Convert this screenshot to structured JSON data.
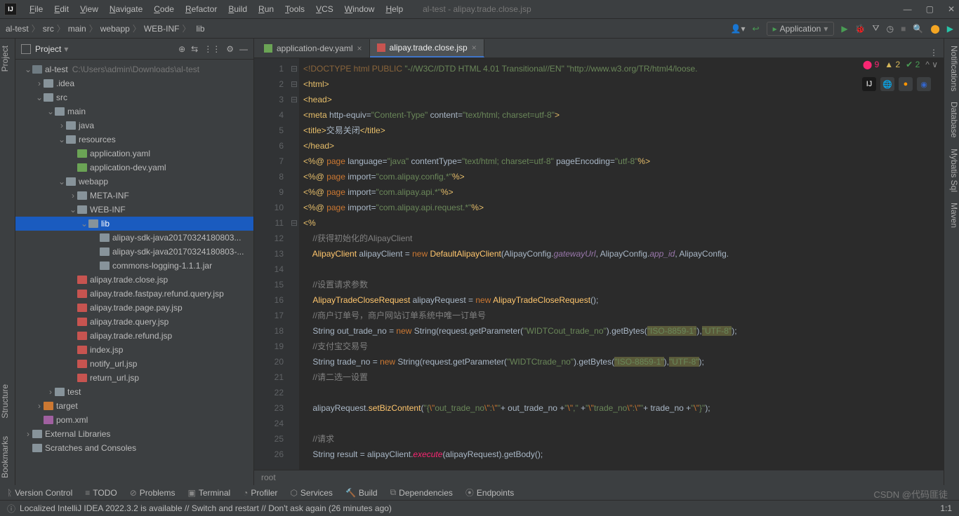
{
  "window_title": "al-test - alipay.trade.close.jsp",
  "menu": [
    "File",
    "Edit",
    "View",
    "Navigate",
    "Code",
    "Refactor",
    "Build",
    "Run",
    "Tools",
    "VCS",
    "Window",
    "Help"
  ],
  "breadcrumbs": [
    "al-test",
    "src",
    "main",
    "webapp",
    "WEB-INF",
    "lib"
  ],
  "run_config": "Application",
  "project_label": "Project",
  "tree": [
    {
      "d": 0,
      "a": "v",
      "i": "fdir-root",
      "t": "al-test",
      "suf": "C:\\Users\\admin\\Downloads\\al-test"
    },
    {
      "d": 1,
      "a": ">",
      "i": "fdir",
      "t": ".idea"
    },
    {
      "d": 1,
      "a": "v",
      "i": "fdir",
      "t": "src"
    },
    {
      "d": 2,
      "a": "v",
      "i": "fdir",
      "t": "main"
    },
    {
      "d": 3,
      "a": ">",
      "i": "fdir",
      "t": "java"
    },
    {
      "d": 3,
      "a": "v",
      "i": "fdir",
      "t": "resources"
    },
    {
      "d": 4,
      "a": "",
      "i": "fyaml",
      "t": "application.yaml"
    },
    {
      "d": 4,
      "a": "",
      "i": "fyaml",
      "t": "application-dev.yaml"
    },
    {
      "d": 3,
      "a": "v",
      "i": "fdir",
      "t": "webapp"
    },
    {
      "d": 4,
      "a": ">",
      "i": "fdir",
      "t": "META-INF"
    },
    {
      "d": 4,
      "a": "v",
      "i": "fdir",
      "t": "WEB-INF"
    },
    {
      "d": 5,
      "a": "v",
      "i": "fdir",
      "t": "lib",
      "sel": true
    },
    {
      "d": 6,
      "a": "",
      "i": "fjar",
      "t": "alipay-sdk-java20170324180803..."
    },
    {
      "d": 6,
      "a": "",
      "i": "fjar",
      "t": "alipay-sdk-java20170324180803-..."
    },
    {
      "d": 6,
      "a": "",
      "i": "fjar",
      "t": "commons-logging-1.1.1.jar"
    },
    {
      "d": 4,
      "a": "",
      "i": "fjsp",
      "t": "alipay.trade.close.jsp"
    },
    {
      "d": 4,
      "a": "",
      "i": "fjsp",
      "t": "alipay.trade.fastpay.refund.query.jsp"
    },
    {
      "d": 4,
      "a": "",
      "i": "fjsp",
      "t": "alipay.trade.page.pay.jsp"
    },
    {
      "d": 4,
      "a": "",
      "i": "fjsp",
      "t": "alipay.trade.query.jsp"
    },
    {
      "d": 4,
      "a": "",
      "i": "fjsp",
      "t": "alipay.trade.refund.jsp"
    },
    {
      "d": 4,
      "a": "",
      "i": "fjsp",
      "t": "index.jsp"
    },
    {
      "d": 4,
      "a": "",
      "i": "fjsp",
      "t": "notify_url.jsp"
    },
    {
      "d": 4,
      "a": "",
      "i": "fjsp",
      "t": "return_url.jsp"
    },
    {
      "d": 2,
      "a": ">",
      "i": "fdir",
      "t": "test"
    },
    {
      "d": 1,
      "a": ">",
      "i": "flib-orange",
      "t": "target"
    },
    {
      "d": 1,
      "a": "",
      "i": "flib-purple",
      "t": "pom.xml",
      "italic": true,
      "col": "#8888cc"
    },
    {
      "d": 0,
      "a": ">",
      "i": "fdir",
      "t": "External Libraries"
    },
    {
      "d": 0,
      "a": "",
      "i": "fdir",
      "t": "Scratches and Consoles"
    }
  ],
  "tabs": [
    {
      "label": "application-dev.yaml",
      "icon": "fyaml",
      "active": false
    },
    {
      "label": "alipay.trade.close.jsp",
      "icon": "fjsp",
      "active": true
    }
  ],
  "line_count": 26,
  "code_lines": [
    "<span class='doc'>&lt;!DOCTYPE html PUBLIC </span><span class='str'>\"-//W3C//DTD HTML 4.01 Transitional//EN\"</span> <span class='str'>\"http://www.w3.org/TR/html4/loose.</span>",
    "<span class='tag'>&lt;html&gt;</span>",
    "<span class='tag'>&lt;head&gt;</span>",
    "<span class='tag'>&lt;meta </span><span>http-equiv=</span><span class='str'>\"Content-Type\"</span> content=<span class='str'>\"text/html; charset=utf-8\"</span><span class='tag'>&gt;</span>",
    "<span class='tag'>&lt;title&gt;</span>交易关闭<span class='tag'>&lt;/title&gt;</span>",
    "<span class='tag'>&lt;/head&gt;</span>",
    "<span class='tag'>&lt;%@ </span><span class='kw'>page </span>language=<span class='str'>\"java\"</span> contentType=<span class='str'>\"text/html; charset=utf-8\"</span> pageEncoding=<span class='str'>\"utf-8\"</span><span class='tag'>%&gt;</span>",
    "<span class='tag'>&lt;%@ </span><span class='kw'>page </span>import=<span class='str'>\"com.alipay.config.*\"</span><span class='tag'>%&gt;</span>",
    "<span class='tag'>&lt;%@ </span><span class='kw'>page </span>import=<span class='str'>\"com.alipay.api.*\"</span><span class='tag'>%&gt;</span>",
    "<span class='tag'>&lt;%@ </span><span class='kw'>page </span>import=<span class='str'>\"com.alipay.api.request.*\"</span><span class='tag'>%&gt;</span>",
    "<span class='tag'>&lt;%</span>",
    "    <span class='cmt'>//获得初始化的AlipayClient</span>",
    "    <span class='cls'>AlipayClient</span> alipayClient = <span class='kw'>new</span> <span class='cls'>DefaultAlipayClient</span>(AlipayConfig.<span class='field'>gatewayUrl</span>, AlipayConfig.<span class='field'>app_id</span>, AlipayConfig.",
    "",
    "    <span class='cmt'>//设置请求参数</span>",
    "    <span class='cls'>AlipayTradeCloseRequest</span> alipayRequest = <span class='kw'>new</span> <span class='cls'>AlipayTradeCloseRequest</span>();",
    "    <span class='cmt'>//商户订单号，商户网站订单系统中唯一订单号</span>",
    "    String out_trade_no = <span class='kw'>new</span> String(request.getParameter(<span class='str'>\"WIDTCout_trade_no\"</span>).getBytes(<span class='str-hi'>\"ISO-8859-1\"</span>),<span class='str-hi'>\"UTF-8\"</span>);",
    "    <span class='cmt'>//支付宝交易号</span>",
    "    String trade_no = <span class='kw'>new</span> String(request.getParameter(<span class='str'>\"WIDTCtrade_no\"</span>).getBytes(<span class='str-hi'>\"ISO-8859-1\"</span>),<span class='str-hi'>\"UTF-8\"</span>);",
    "    <span class='cmt'>//请二选一设置</span>",
    "",
    "    alipayRequest.<span class='fn'>setBizContent</span>(<span class='str'>\"{</span><span class='kw'>\\\"</span><span class='str'>out_trade_no</span><span class='kw'>\\\"</span><span class='str'>:</span><span class='kw'>\\\"</span><span class='str'>\"</span>+ out_trade_no +<span class='str'>\"</span><span class='kw'>\\\"</span><span class='str'>,\" </span>+<span class='str'>\"</span><span class='kw'>\\\"</span><span class='str'>trade_no</span><span class='kw'>\\\"</span><span class='str'>:</span><span class='kw'>\\\"</span><span class='str'>\"</span>+ trade_no +<span class='str'>\"</span><span class='kw'>\\\"</span><span class='str'>}\"</span>);",
    "",
    "    <span class='cmt'>//请求</span>",
    "    String result = alipayClient.<span class='fn-err'>execute</span>(alipayRequest).getBody();"
  ],
  "crumb_inner": "root",
  "inspect": {
    "err": "9",
    "warn": "2",
    "ok": "2"
  },
  "bottom_tools": [
    "Version Control",
    "TODO",
    "Problems",
    "Terminal",
    "Profiler",
    "Services",
    "Build",
    "Dependencies",
    "Endpoints"
  ],
  "status_msg": "Localized IntelliJ IDEA 2022.3.2 is available // Switch and restart // Don't ask again (26 minutes ago)",
  "status_pos": "1:1",
  "watermark": "CSDN @代码匪徒",
  "left_tabs": [
    "Project",
    "Bookmarks",
    "Structure"
  ],
  "right_tabs": [
    "Notifications",
    "Database",
    "Mybatis Sql",
    "Maven"
  ]
}
